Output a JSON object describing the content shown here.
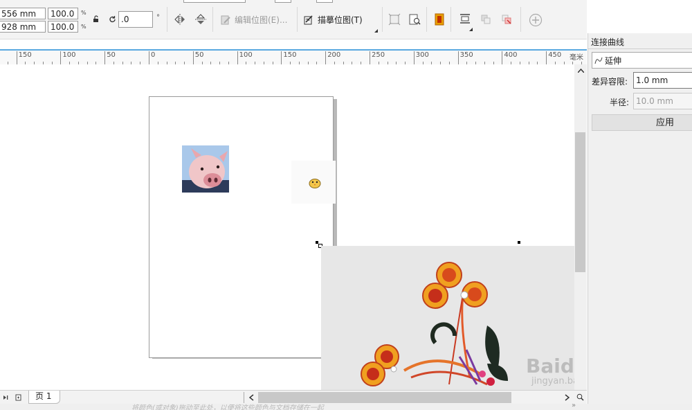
{
  "propbar": {
    "width_value": "556 mm",
    "height_value": "928 mm",
    "scale_x": "100.0",
    "scale_y": "100.0",
    "percent_unit": "%",
    "angle_value": ".0",
    "degree_unit": "°",
    "edit_bitmap_label": "编辑位图(E)...",
    "trace_bitmap_label": "描摹位图(T)"
  },
  "ruler": {
    "labels": [
      "150",
      "100",
      "50",
      "0",
      "50",
      "100",
      "150",
      "200",
      "250",
      "300",
      "350",
      "400",
      "450"
    ],
    "unit": "毫米"
  },
  "docker": {
    "title": "连接曲线",
    "mode_value": "延伸",
    "tolerance_label": "差异容限:",
    "tolerance_value": "1.0 mm",
    "radius_label": "半径:",
    "radius_value": "10.0 mm",
    "apply_label": "应用"
  },
  "bottom": {
    "page_tab": "页 1"
  },
  "status": {
    "hint": "将颜色(或对象)拖动至此处，以便将这些颜色与文档存储在一起"
  },
  "watermark": {
    "brand": "Baidu经验",
    "url": "jingyan.baidu.com"
  }
}
